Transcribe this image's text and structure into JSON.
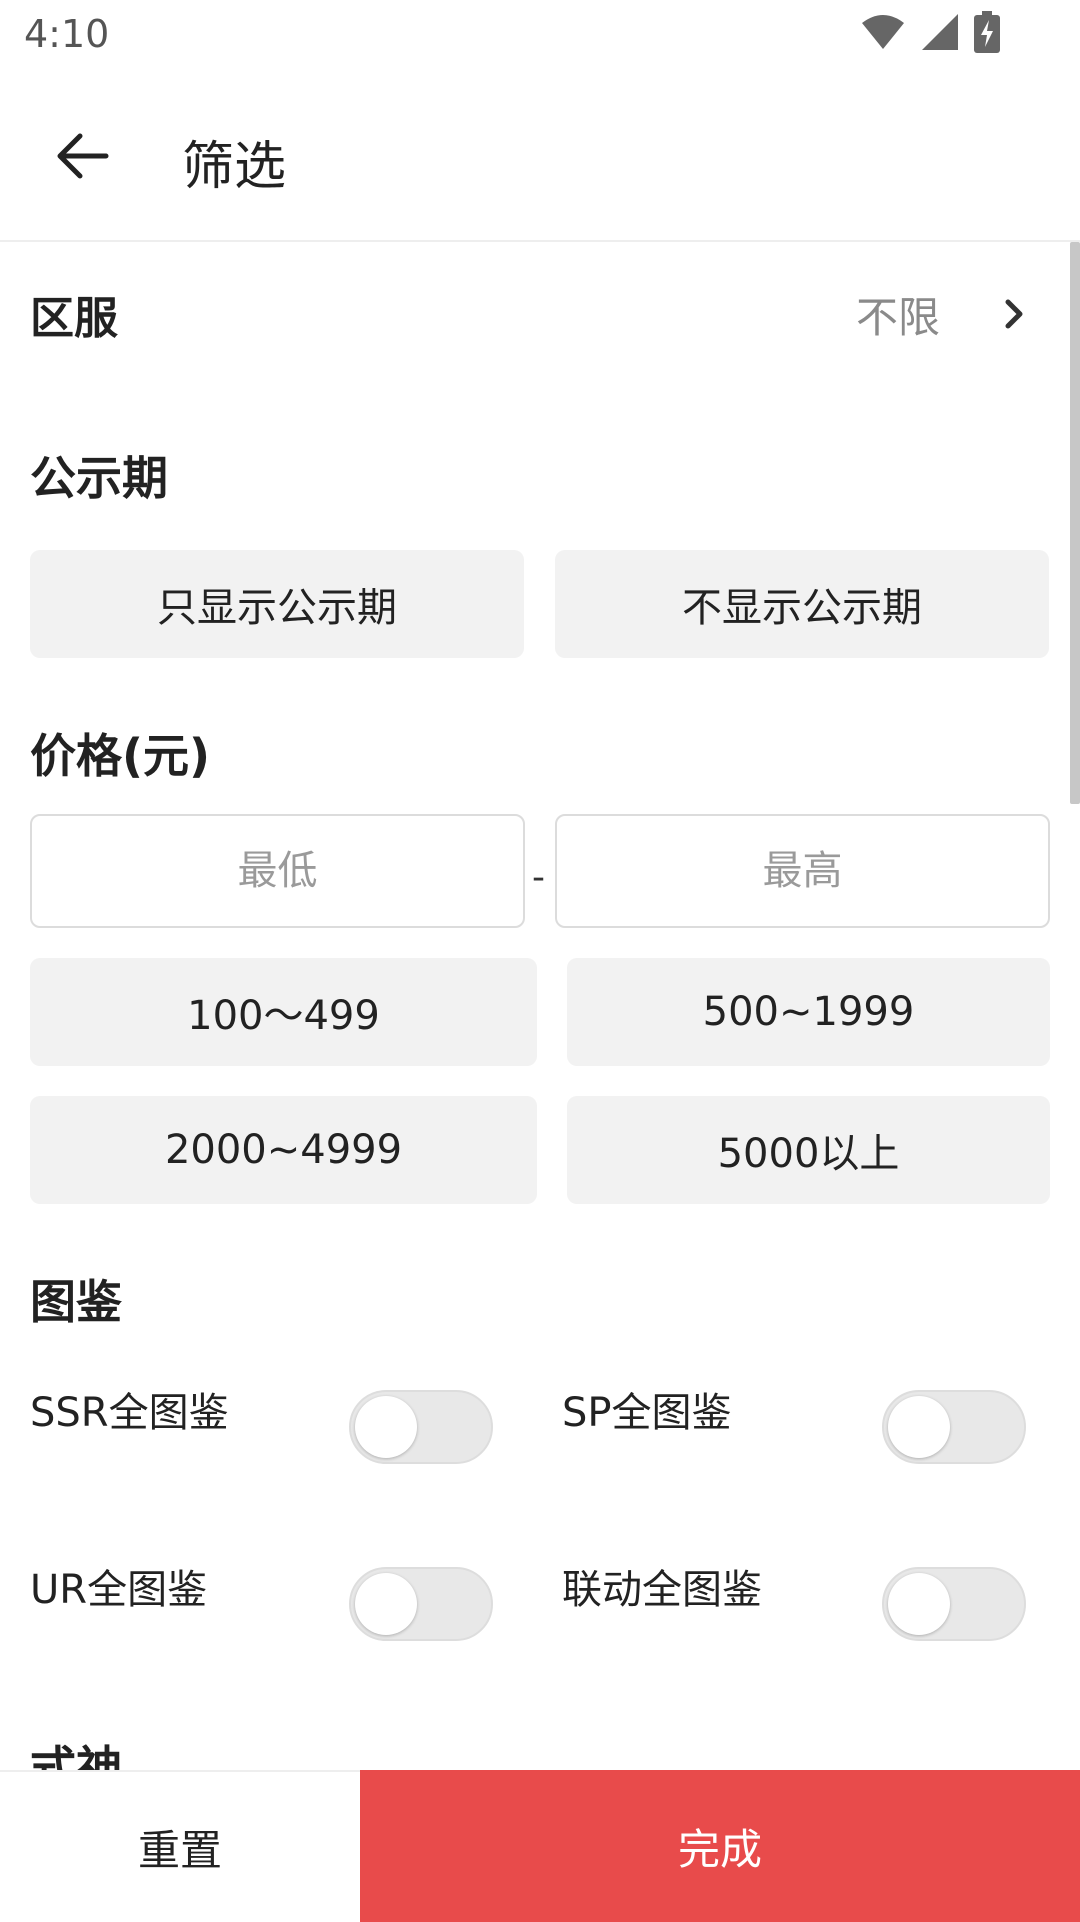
{
  "status_bar": {
    "time": "4:10",
    "icons": [
      "wifi-icon",
      "signal-icon",
      "battery-charging-icon"
    ]
  },
  "app_bar": {
    "back_icon": "back-arrow-icon",
    "title": "筛选"
  },
  "region": {
    "label": "区服",
    "value": "不限",
    "chevron_icon": "chevron-right-icon"
  },
  "publicity": {
    "title": "公示期",
    "options": [
      "只显示公示期",
      "不显示公示期"
    ]
  },
  "price": {
    "title": "价格(元)",
    "min_placeholder": "最低",
    "max_placeholder": "最高",
    "separator": "-",
    "ranges": [
      "100～499",
      "500~1999",
      "2000~4999",
      "5000以上"
    ]
  },
  "collection": {
    "title": "图鉴",
    "toggles": [
      {
        "label": "SSR全图鉴",
        "on": false
      },
      {
        "label": "SP全图鉴",
        "on": false
      },
      {
        "label": "UR全图鉴",
        "on": false
      },
      {
        "label": "联动全图鉴",
        "on": false
      }
    ]
  },
  "shikigami": {
    "title": "式神"
  },
  "actions": {
    "reset_label": "重置",
    "done_label": "完成"
  },
  "colors": {
    "accent": "#e84b4b",
    "chip_bg": "#f2f2f2",
    "muted_text": "#8a8a8a"
  }
}
